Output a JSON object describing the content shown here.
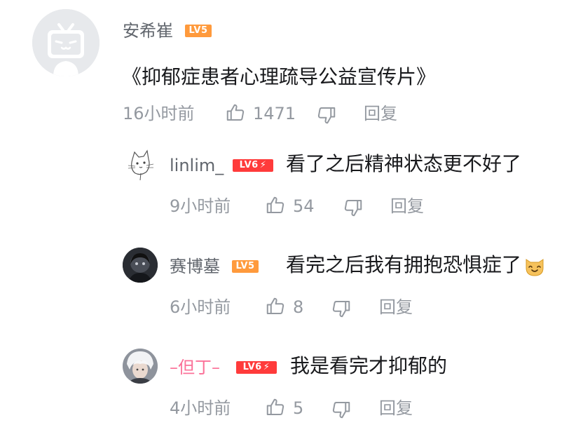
{
  "comments": [
    {
      "user": "安希崔",
      "level": "LV5",
      "content": "《抑郁症患者心理疏导公益宣传片》",
      "time": "16小时前",
      "likes": "1471",
      "reply_label": "回复"
    }
  ],
  "replies": [
    {
      "user": "linlim_",
      "level": "LV6",
      "content": "看了之后精神状态更不好了",
      "time": "9小时前",
      "likes": "54",
      "reply_label": "回复"
    },
    {
      "user": "赛博墓",
      "level": "LV5",
      "content": "看完之后我有拥抱恐惧症了",
      "emoji": "cat-smile-emoji",
      "time": "6小时前",
      "likes": "8",
      "reply_label": "回复"
    },
    {
      "user": "–但丁–",
      "level": "LV6",
      "content": "我是看完才抑郁的",
      "time": "4小时前",
      "likes": "5",
      "reply_label": "回复"
    }
  ],
  "colors": {
    "username": "#61666d",
    "username_highlight": "#fb7299",
    "meta": "#9499a0",
    "text": "#18191c",
    "lv5": "#ff9a3c",
    "lv6": "#ff3b3b"
  }
}
